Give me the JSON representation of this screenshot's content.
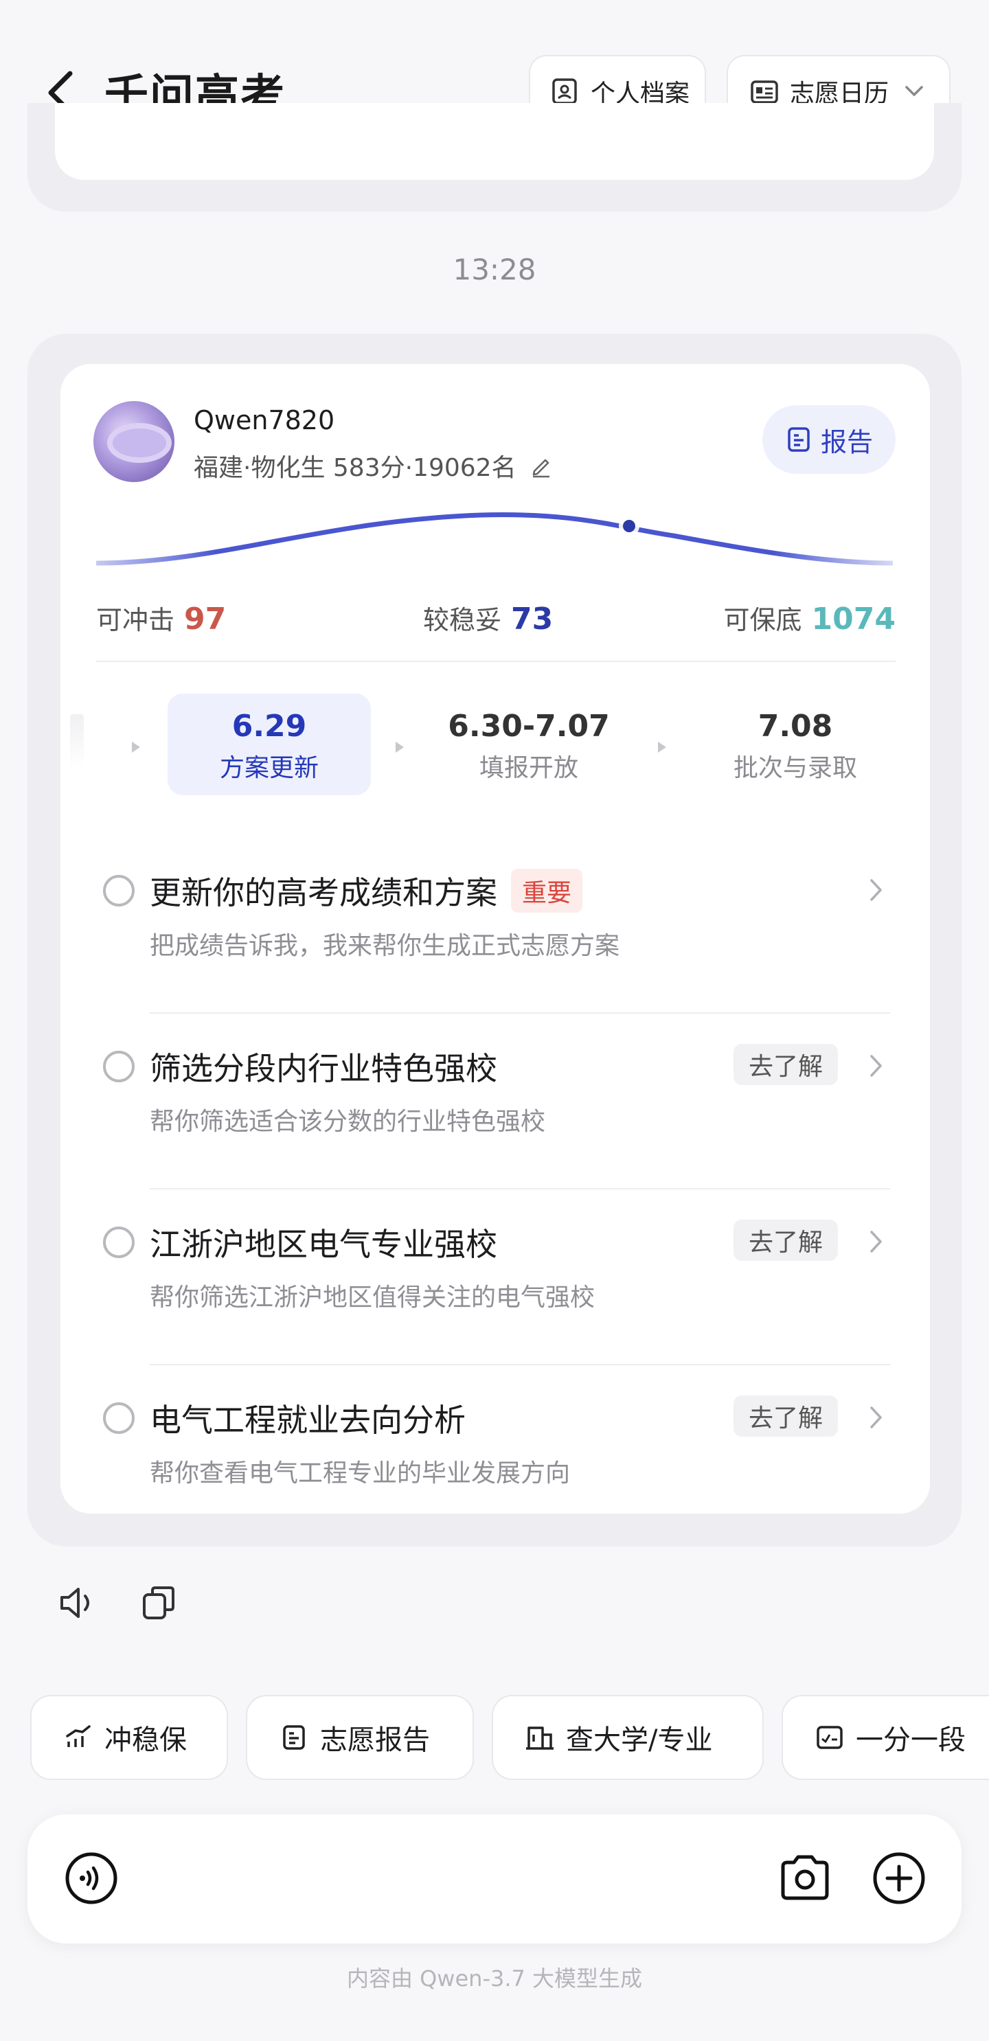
{
  "header": {
    "title": "千问高考",
    "profile_label": "个人档案",
    "calendar_label": "志愿日历"
  },
  "timestamp": "13:28",
  "user": {
    "name": "Qwen7820",
    "info": "福建·物化生 583分·19062名"
  },
  "report_label": "报告",
  "stats": {
    "rush_label": "可冲击",
    "rush_value": "97",
    "stable_label": "较稳妥",
    "stable_value": "73",
    "safe_label": "可保底",
    "safe_value": "1074"
  },
  "timeline": [
    {
      "date": "6.29",
      "label": "方案更新",
      "active": true
    },
    {
      "date": "6.30-7.07",
      "label": "填报开放",
      "active": false
    },
    {
      "date": "7.08",
      "label": "批次与录取",
      "active": false
    }
  ],
  "tasks": [
    {
      "title": "更新你的高考成绩和方案",
      "badge": "重要",
      "subtitle": "把成绩告诉我，我来帮你生成正式志愿方案",
      "action": ""
    },
    {
      "title": "筛选分段内行业特色强校",
      "badge": "",
      "subtitle": "帮你筛选适合该分数的行业特色强校",
      "action": "去了解"
    },
    {
      "title": "江浙沪地区电气专业强校",
      "badge": "",
      "subtitle": "帮你筛选江浙沪地区值得关注的电气强校",
      "action": "去了解"
    },
    {
      "title": "电气工程就业去向分析",
      "badge": "",
      "subtitle": "帮你查看电气工程专业的毕业发展方向",
      "action": "去了解"
    }
  ],
  "chips": [
    {
      "label": "冲稳保",
      "icon": "chart-icon"
    },
    {
      "label": "志愿报告",
      "icon": "report-icon"
    },
    {
      "label": "查大学/专业",
      "icon": "building-icon"
    },
    {
      "label": "一分一段",
      "icon": "score-table-icon"
    }
  ],
  "input": {
    "placeholder": ""
  },
  "footer": "内容由 Qwen-3.7 大模型生成",
  "colors": {
    "accent": "#2538b8",
    "rush": "#c9574a",
    "stable": "#2c3aa8",
    "safe": "#5ab8bb",
    "important": "#d9453c"
  }
}
